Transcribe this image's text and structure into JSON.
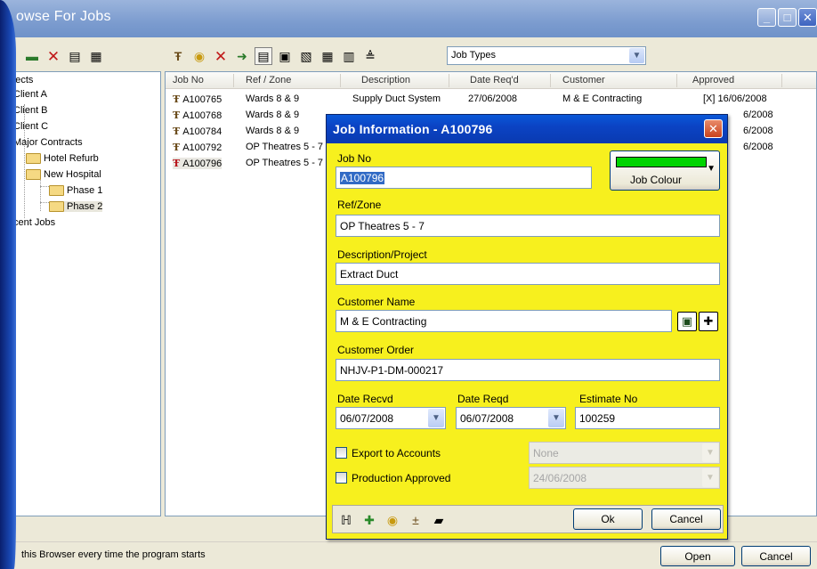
{
  "window": {
    "title": "owse For Jobs"
  },
  "toolbar": {
    "job_types": "Job Types"
  },
  "tree": {
    "items": [
      {
        "label": "rojects"
      },
      {
        "label": "Client A"
      },
      {
        "label": "Client B"
      },
      {
        "label": "Client C"
      },
      {
        "label": "Major Contracts"
      },
      {
        "label": "Hotel Refurb"
      },
      {
        "label": "New Hospital"
      },
      {
        "label": "Phase 1"
      },
      {
        "label": "Phase 2"
      },
      {
        "label": "cent Jobs"
      }
    ]
  },
  "list": {
    "columns": [
      "Job No",
      "Ref / Zone",
      "Description",
      "Date Req'd",
      "Customer",
      "Approved"
    ],
    "rows": [
      {
        "job": "A100765",
        "ref": "Wards 8 & 9",
        "desc": "Supply Duct System",
        "date": "27/06/2008",
        "customer": "M & E Contracting",
        "approved": "[X] 16/06/2008"
      },
      {
        "job": "A100768",
        "ref": "Wards 8 & 9",
        "desc": "",
        "date": "",
        "customer": "",
        "approved": "6/2008"
      },
      {
        "job": "A100784",
        "ref": "Wards 8 & 9",
        "desc": "",
        "date": "",
        "customer": "",
        "approved": "6/2008"
      },
      {
        "job": "A100792",
        "ref": "OP Theatres 5 - 7",
        "desc": "",
        "date": "",
        "customer": "",
        "approved": "6/2008"
      },
      {
        "job": "A100796",
        "ref": "OP Theatres 5 - 7",
        "desc": "",
        "date": "",
        "customer": "",
        "approved": ""
      }
    ]
  },
  "status": {
    "text": "this Browser every time the program starts",
    "open": "Open",
    "cancel": "Cancel"
  },
  "dialog": {
    "title": "Job Information - A100796",
    "job_no_label": "Job No",
    "job_no": "A100796",
    "job_colour_label": "Job Colour",
    "job_colour": "#00d400",
    "ref_label": "Ref/Zone",
    "ref": "OP Theatres 5 - 7",
    "desc_label": "Description/Project",
    "desc": "Extract Duct",
    "customer_label": "Customer Name",
    "customer": "M & E Contracting",
    "order_label": "Customer Order",
    "order": "NHJV-P1-DM-000217",
    "date_recvd_label": "Date Recvd",
    "date_recvd": "06/07/2008",
    "date_reqd_label": "Date Reqd",
    "date_reqd": "06/07/2008",
    "estimate_label": "Estimate No",
    "estimate": "100259",
    "export_label": "Export to Accounts",
    "export_value": "None",
    "production_label": "Production Approved",
    "production_value": "24/06/2008",
    "ok": "Ok",
    "cancel": "Cancel"
  }
}
